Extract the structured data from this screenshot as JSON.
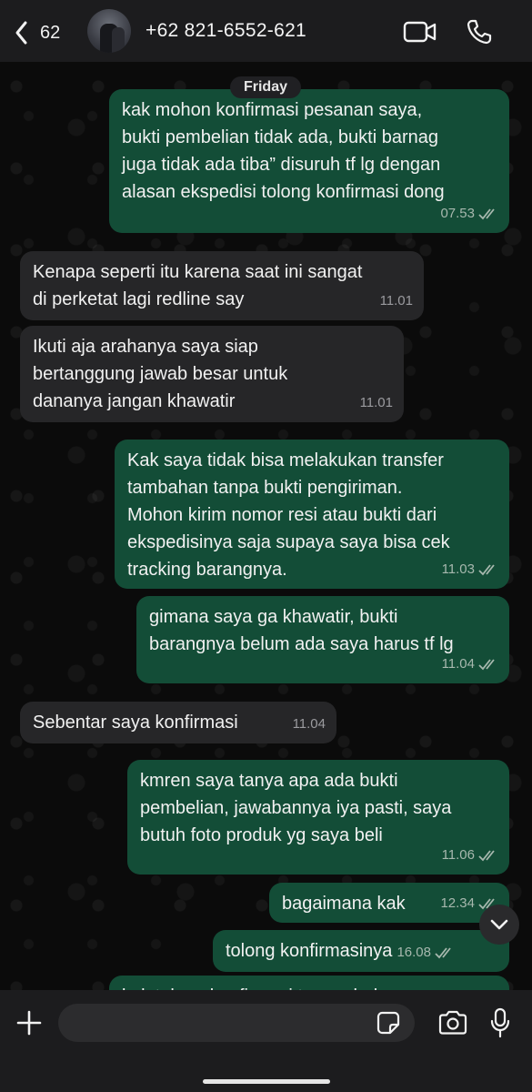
{
  "header": {
    "back_count": "62",
    "contact_name": "+62 821-6552-621"
  },
  "chat": {
    "day_label": "Friday",
    "messages": [
      {
        "direction": "out",
        "text": "kak mohon konfirmasi pesanan saya,\nbukti pembelian tidak ada, bukti barnag\njuga tidak ada tiba” disuruh tf lg dengan\nalasan ekspedisi tolong konfirmasi dong",
        "time": "07.53",
        "read": true
      },
      {
        "direction": "in",
        "text": "Kenapa seperti itu karena saat ini sangat\ndi perketat lagi redline say",
        "time": "11.01"
      },
      {
        "direction": "in",
        "text": "Ikuti aja arahanya saya siap\nbertanggung jawab besar untuk\ndananya jangan khawatir",
        "time": "11.01"
      },
      {
        "direction": "out",
        "text": "Kak saya tidak bisa melakukan transfer\ntambahan tanpa bukti pengiriman.\nMohon kirim nomor resi atau bukti dari\nekspedisinya saja supaya saya bisa cek\ntracking barangnya.",
        "time": "11.03",
        "read": true
      },
      {
        "direction": "out",
        "text": "gimana saya ga khawatir, bukti\nbarangnya belum ada saya harus tf lg",
        "time": "11.04",
        "read": true
      },
      {
        "direction": "in",
        "text": "Sebentar saya konfirmasi",
        "time": "11.04"
      },
      {
        "direction": "out",
        "text": "kmren saya tanya apa ada bukti\npembelian, jawabannya iya pasti, saya\nbutuh foto produk yg saya beli",
        "time": "11.06",
        "read": true
      },
      {
        "direction": "out",
        "text": "bagaimana kak",
        "time": "12.34",
        "read": true
      },
      {
        "direction": "out",
        "text": "tolong konfirmasinya",
        "time": "16.08",
        "read": true
      },
      {
        "direction": "out",
        "text": "kak tolong konfirmasi terus ahalnya",
        "time": "",
        "read": false
      }
    ]
  },
  "composer": {
    "input_value": "",
    "input_placeholder": ""
  },
  "colors": {
    "outgoing_bubble": "#134d37",
    "incoming_bubble": "#262628",
    "read_ticks": "#a7b8ae"
  },
  "icons": {
    "back": "chevron-left-icon",
    "video": "video-camera-icon",
    "call": "phone-icon",
    "scroll_down": "chevron-down-icon",
    "attach": "plus-icon",
    "sticker": "sticker-icon",
    "camera": "camera-icon",
    "mic": "microphone-icon"
  }
}
